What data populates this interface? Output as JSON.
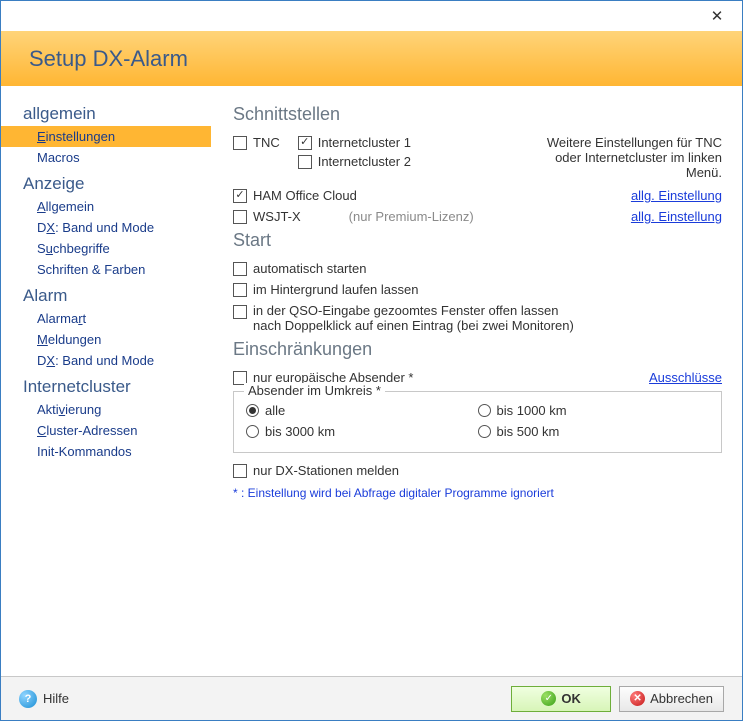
{
  "window": {
    "title": "Setup DX-Alarm"
  },
  "sidebar": {
    "groups": [
      {
        "title": "allgemein",
        "items": [
          {
            "label": "Einstellungen",
            "u": "E",
            "rest": "instellungen",
            "selected": true
          },
          {
            "label": "Macros",
            "u": "",
            "rest": "Macros"
          }
        ]
      },
      {
        "title": "Anzeige",
        "items": [
          {
            "u": "A",
            "rest": "llgemein"
          },
          {
            "pre": "D",
            "u": "X",
            "rest": ": Band und Mode"
          },
          {
            "pre": "S",
            "u": "u",
            "rest": "chbegriffe"
          },
          {
            "u": "",
            "rest": "Schriften & Farben"
          }
        ]
      },
      {
        "title": "Alarm",
        "items": [
          {
            "pre": "Alarma",
            "u": "r",
            "rest": "t"
          },
          {
            "u": "M",
            "rest": "eldungen"
          },
          {
            "pre": "D",
            "u": "X",
            "rest": ": Band und Mode"
          }
        ]
      },
      {
        "title": "Internetcluster",
        "items": [
          {
            "pre": "Akti",
            "u": "v",
            "rest": "ierung"
          },
          {
            "u": "C",
            "rest": "luster-Adressen"
          },
          {
            "u": "",
            "rest": "Init-Kommandos"
          }
        ]
      }
    ]
  },
  "content": {
    "schnittstellen": {
      "title": "Schnittstellen",
      "tnc": "TNC",
      "ic1": "Internetcluster 1",
      "ic2": "Internetcluster 2",
      "hint": "Weitere Einstellungen für TNC oder Internetcluster im linken Menü.",
      "ham": "HAM Office Cloud",
      "wsjt": "WSJT-X",
      "wsjt_note": "(nur Premium-Lizenz)",
      "link": "allg. Einstellung"
    },
    "start": {
      "title": "Start",
      "auto": "automatisch starten",
      "bg": "im Hintergrund laufen lassen",
      "zoom1": "in der QSO-Eingabe gezoomtes Fenster offen lassen",
      "zoom2": "nach Doppelklick auf einen Eintrag (bei zwei Monitoren)"
    },
    "einschr": {
      "title": "Einschränkungen",
      "eur": "nur europäische Absender *",
      "aus": "Ausschlüsse",
      "legend": "Absender im Umkreis *",
      "r_alle": "alle",
      "r_1000": "bis 1000 km",
      "r_3000": "bis 3000 km",
      "r_500": "bis 500 km",
      "dx": "nur DX-Stationen melden",
      "foot": "* : Einstellung wird bei Abfrage digitaler Programme  ignoriert"
    }
  },
  "footer": {
    "help": "Hilfe",
    "ok": "OK",
    "cancel": "Abbrechen"
  }
}
